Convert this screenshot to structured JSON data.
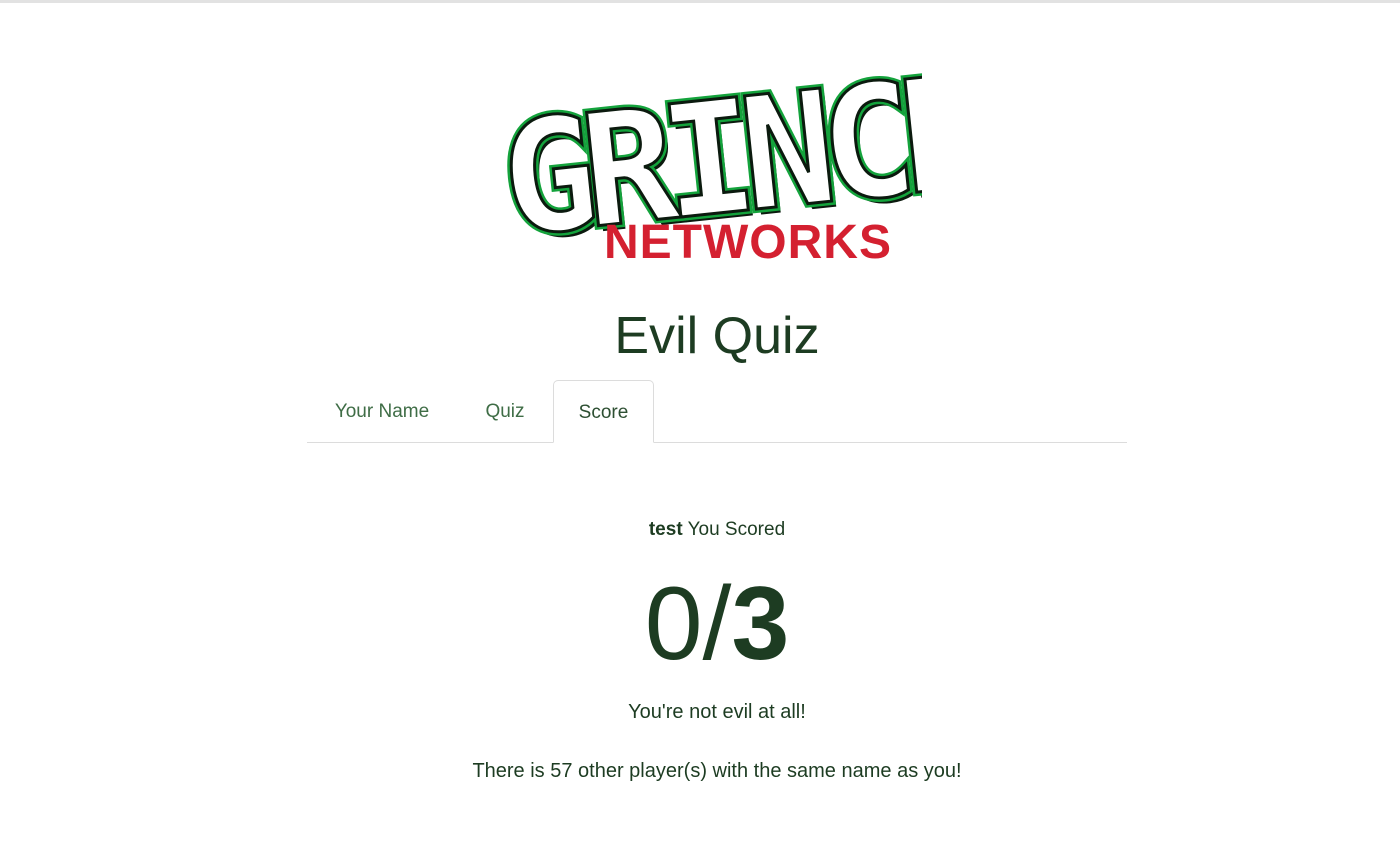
{
  "logo": {
    "word_top": "GRINCH",
    "word_bottom": "NETWORKS",
    "colors": {
      "green": "#14a33c",
      "red": "#d42030",
      "outline": "#0b1a0e",
      "fill": "#ffffff"
    }
  },
  "page": {
    "title": "Evil Quiz"
  },
  "tabs": [
    {
      "label": "Your Name",
      "active": false
    },
    {
      "label": "Quiz",
      "active": false
    },
    {
      "label": "Score",
      "active": true
    }
  ],
  "result": {
    "player_name": "test",
    "scored_label": "You Scored",
    "score_correct": "0",
    "score_separator": "/",
    "score_total": "3",
    "verdict": "You're not evil at all!",
    "same_name_message": "There is 57 other player(s) with the same name as you!"
  },
  "colors": {
    "text": "#1d3c22",
    "tab_text": "#3f6d46",
    "border": "#dcdcdc"
  }
}
